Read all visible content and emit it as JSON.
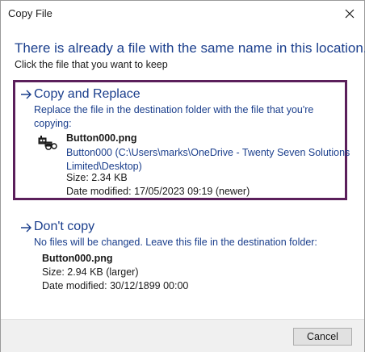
{
  "window": {
    "title": "Copy File",
    "close_icon": "close-icon"
  },
  "heading": "There is already a file with the same name in this location.",
  "subheading": "Click the file that you want to keep",
  "replace_option": {
    "title": "Copy and Replace",
    "description_line1": "Replace the file in the destination folder with the file that you're",
    "description_line2": "copying:",
    "file_icon": "robot-file-icon",
    "file_name": "Button000.png",
    "path_line1": "Button000 (C:\\Users\\marks\\OneDrive - Twenty Seven Solutions",
    "path_line2": "Limited\\Desktop)",
    "size": "Size: 2.34 KB",
    "date_modified": "Date modified: 17/05/2023 09:19 (newer)"
  },
  "dont_copy_option": {
    "title": "Don't copy",
    "description": "No files will be changed. Leave this file in the destination folder:",
    "file_name": "Button000.png",
    "size": "Size: 2.94 KB (larger)",
    "date_modified": "Date modified: 30/12/1899 00:00"
  },
  "footer": {
    "cancel_label": "Cancel"
  },
  "colors": {
    "link_blue": "#1a3e8c",
    "highlight_border": "#5b1f5b"
  }
}
